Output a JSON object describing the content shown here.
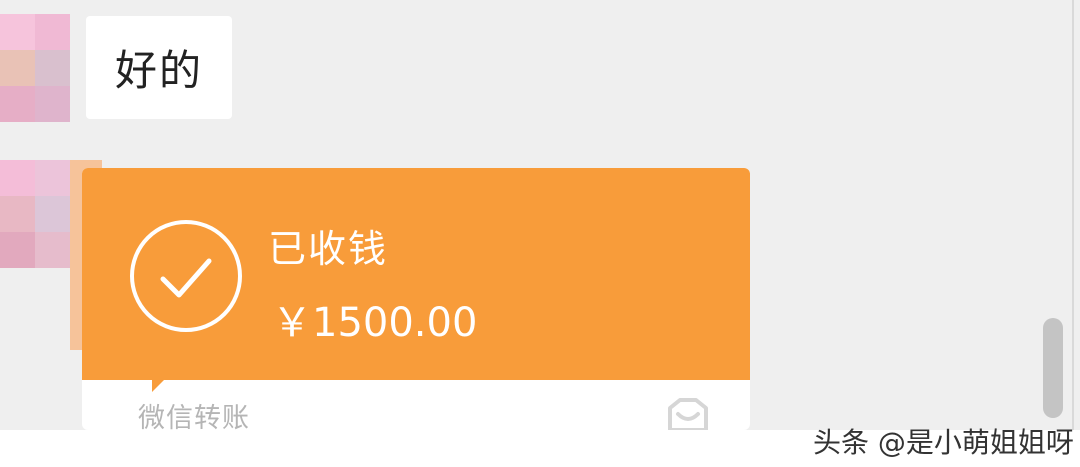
{
  "messages": {
    "text_reply": "好的",
    "transfer": {
      "status": "已收钱",
      "amount": "￥1500.00",
      "footer_label": "微信转账",
      "status_icon": "check-circle-icon",
      "footer_icon": "wechat-pay-icon",
      "color": "#f89c3a"
    }
  },
  "watermark": "头条 @是小萌姐姐呀"
}
